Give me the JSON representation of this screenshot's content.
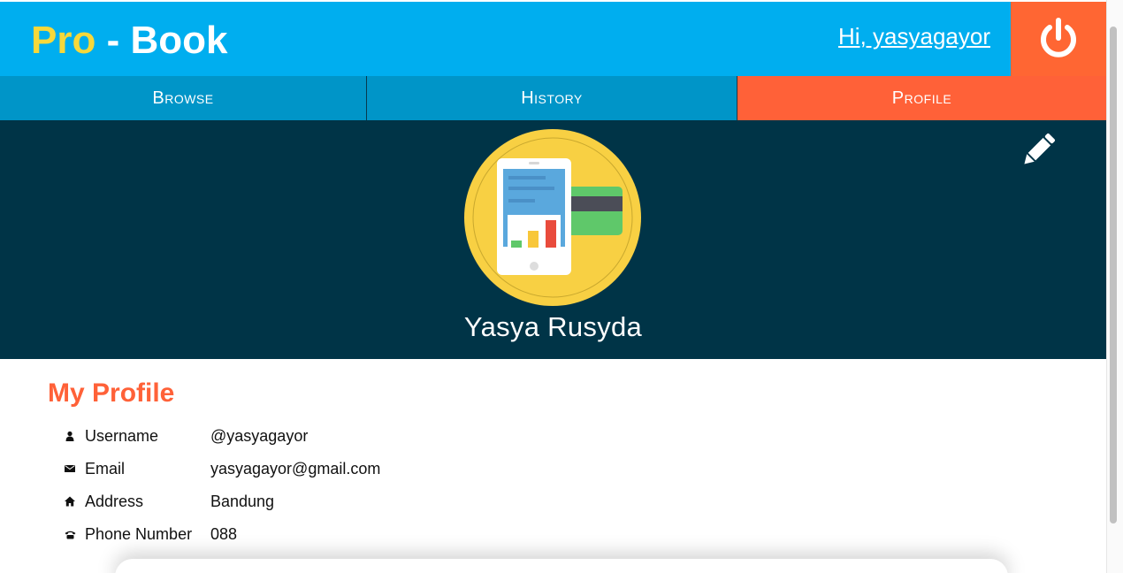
{
  "header": {
    "logo_pro": "Pro",
    "logo_rest": " - Book",
    "greeting": "Hi, yasyagayor",
    "logout_icon": "power-icon"
  },
  "nav": {
    "tabs": [
      {
        "label": "Browse",
        "active": false
      },
      {
        "label": "History",
        "active": false
      },
      {
        "label": "Profile",
        "active": true
      }
    ]
  },
  "banner": {
    "full_name": "Yasya Rusyda",
    "edit_icon": "pencil-icon",
    "avatar_icon": "phone-payment-avatar"
  },
  "profile": {
    "title": "My Profile",
    "fields": [
      {
        "icon": "user-icon",
        "label": "Username",
        "value": "@yasyagayor"
      },
      {
        "icon": "envelope-icon",
        "label": "Email",
        "value": "yasyagayor@gmail.com"
      },
      {
        "icon": "home-icon",
        "label": "Address",
        "value": "Bandung"
      },
      {
        "icon": "phone-icon",
        "label": "Phone Number",
        "value": "088"
      }
    ]
  },
  "colors": {
    "header_bg": "#00aeef",
    "logo_accent": "#f7d83a",
    "accent": "#ff6138",
    "nav_bg": "#0095c8",
    "banner_bg": "#003447"
  }
}
